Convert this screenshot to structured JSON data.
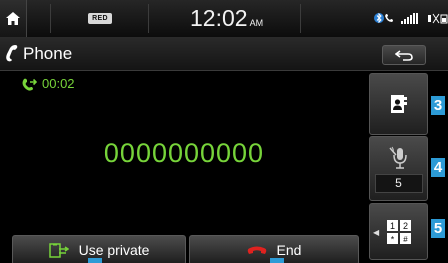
{
  "status_bar": {
    "home_icon": "home-icon",
    "media_badge": "RED",
    "clock_time": "12:02",
    "clock_ampm": "AM",
    "right_icons": [
      "bluetooth-phone-icon",
      "signal-strength-icon",
      "battery-icon"
    ]
  },
  "header": {
    "icon": "phone-handset-icon",
    "title": "Phone",
    "back_icon": "back-arrow-icon"
  },
  "call": {
    "status_icon": "outgoing-call-icon",
    "duration": "00:02",
    "number": "0000000000"
  },
  "buttons": {
    "use_private_label": "Use private",
    "use_private_icon": "private-mode-icon",
    "end_label": "End",
    "end_icon": "end-call-icon"
  },
  "side_panel": {
    "contacts_icon": "contacts-icon",
    "mic_icon": "mic-mute-icon",
    "mic_volume": "5",
    "keypad_icon": "keypad-icon",
    "keypad_keys": [
      "1",
      "2",
      "*",
      "#"
    ]
  },
  "callouts": [
    "3",
    "4",
    "5"
  ],
  "colors": {
    "accent_green": "#77d43a",
    "end_red": "#e0221f",
    "callout_blue": "#2d9bd6"
  }
}
